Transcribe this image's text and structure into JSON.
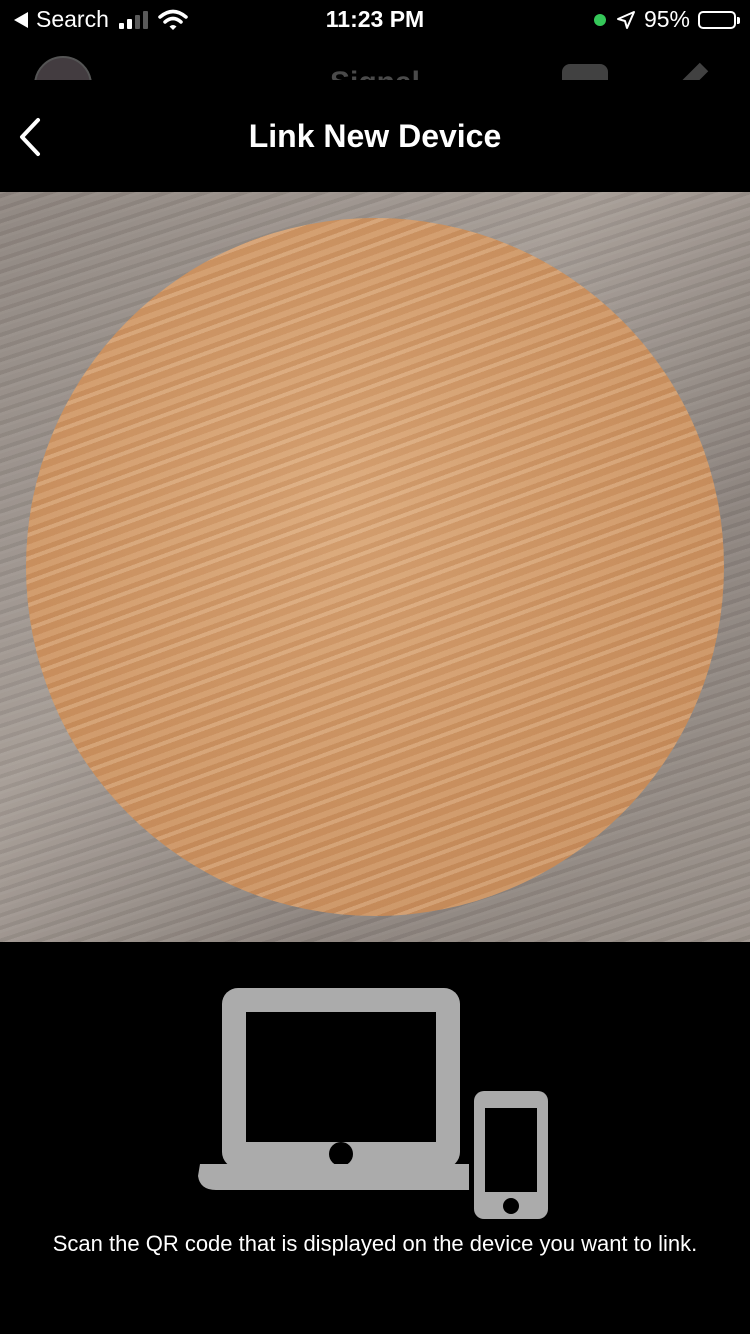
{
  "status_bar": {
    "back_label": "Search",
    "time": "11:23 PM",
    "battery_text": "95%",
    "battery_level": 0.95,
    "signal_bars": 2
  },
  "background": {
    "title": "Signal"
  },
  "nav": {
    "title": "Link New Device"
  },
  "main": {
    "instruction": "Scan the QR code that is displayed on the device you want to link."
  },
  "colors": {
    "illustration": "#ababab",
    "location_dot": "#35c759"
  }
}
